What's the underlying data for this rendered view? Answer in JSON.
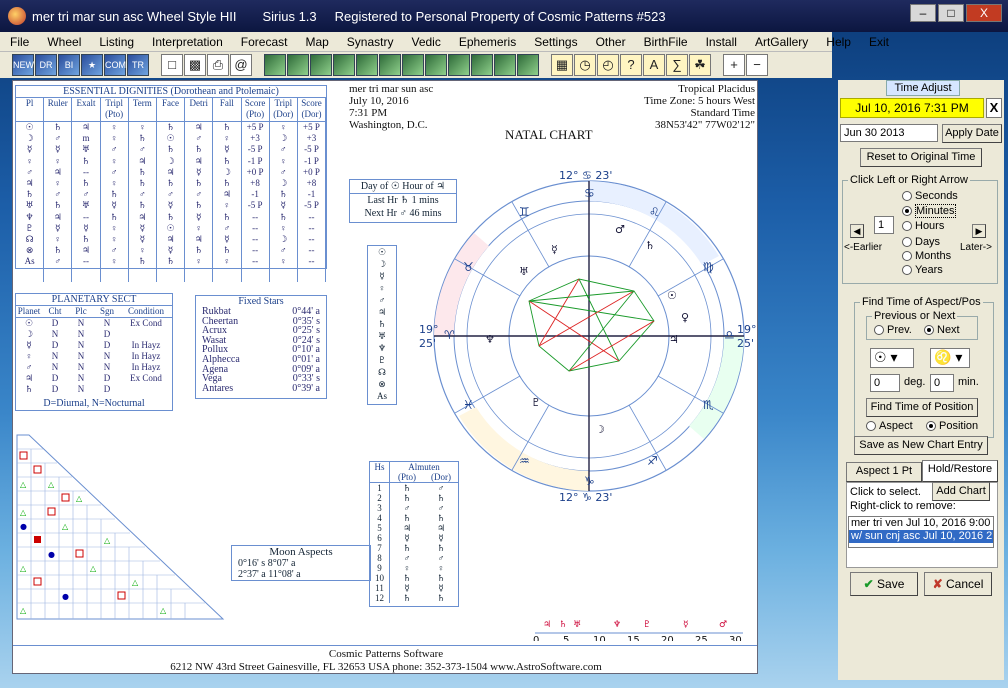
{
  "window": {
    "title": "mer tri mar sun asc Wheel Style HII",
    "app_version": "Sirius 1.3",
    "registered": "Registered to Personal Property of Cosmic Patterns #523",
    "btn_min": "–",
    "btn_max": "□",
    "btn_close": "X"
  },
  "menu": [
    "File",
    "Wheel",
    "Listing",
    "Interpretation",
    "Forecast",
    "Map",
    "Synastry",
    "Vedic",
    "Ephemeris",
    "Settings",
    "Other",
    "BirthFile",
    "Install",
    "ArtGallery",
    "Help",
    "Exit"
  ],
  "toolbar_labels": [
    "NEW",
    "DR",
    "BI",
    "",
    "COMP",
    "TR"
  ],
  "chart": {
    "name": "mer tri mar sun asc",
    "date": "July 10, 2016",
    "time": "7:31 PM",
    "place": "Washington, D.C.",
    "system": "Tropical Placidus",
    "zone": "Time Zone: 5 hours West",
    "standard": "Standard Time",
    "coords": "38N53'42\"  77W02'12\"",
    "natal_title": "NATAL CHART"
  },
  "dignities": {
    "title": "ESSENTIAL DIGNITIES (Dorothean and Ptolemaic)",
    "headers": [
      "Pl",
      "Ruler",
      "Exalt",
      "Tripl (Pto)",
      "Term",
      "Face",
      "Detri",
      "Fall",
      "Score (Pto)",
      "Tripl (Dor)",
      "Score (Dor)"
    ],
    "score_pto": [
      "+5 P",
      "+3",
      "-5 P",
      "-1 P",
      "+0 P",
      "+8",
      "-1",
      "-5 P",
      "--",
      "--",
      "--",
      "--",
      "--"
    ],
    "score_dor": [
      "+5 P",
      "+3",
      "-5 P",
      "-1 P",
      "+0 P",
      "+8",
      "-1",
      "-5 P",
      "--",
      "--",
      "--",
      "--",
      "--"
    ]
  },
  "sect": {
    "title": "PLANETARY SECT",
    "headers": [
      "Planet",
      "Cht",
      "Plc",
      "Sgn",
      "Condition"
    ],
    "rows": [
      [
        "☉",
        "D",
        "N",
        "N",
        "Ex Cond"
      ],
      [
        "☽",
        "N",
        "N",
        "D",
        ""
      ],
      [
        "☿",
        "D",
        "N",
        "D",
        "In Hayz"
      ],
      [
        "♀",
        "N",
        "N",
        "N",
        "In Hayz"
      ],
      [
        "♂",
        "N",
        "N",
        "N",
        "In Hayz"
      ],
      [
        "♃",
        "D",
        "N",
        "D",
        "Ex Cond"
      ],
      [
        "♄",
        "D",
        "N",
        "D",
        ""
      ]
    ],
    "footer": "D=Diurnal, N=Nocturnal"
  },
  "fixed_stars": {
    "title": "Fixed Stars",
    "rows": [
      [
        "Rukbat",
        "0°44' a"
      ],
      [
        "Cheertan",
        "0°35' s"
      ],
      [
        "Acrux",
        "0°25' s"
      ],
      [
        "Wasat",
        "0°24' s"
      ],
      [
        "Pollux",
        "0°10' a"
      ],
      [
        "Alphecca",
        "0°01' a"
      ],
      [
        "Agena",
        "0°09' a"
      ],
      [
        "Vega",
        "0°33' s"
      ],
      [
        "Antares",
        "0°39' a"
      ]
    ]
  },
  "day_hour": {
    "title": "Day of ☉  Hour of ♃",
    "last": "Last Hr ♄  1 mins",
    "next": "Next Hr ♂  46 mins"
  },
  "moon_aspects": {
    "title": "Moon Aspects",
    "rows": [
      "0°16' s   8°07' a",
      "2°37' a  11°08' a"
    ]
  },
  "almuten": {
    "title": "Almuten",
    "col1": "Hs",
    "col2": "(Pto)",
    "col3": "(Dor)",
    "houses": [
      "1",
      "2",
      "3",
      "4",
      "5",
      "6",
      "7",
      "8",
      "9",
      "10",
      "11",
      "12"
    ]
  },
  "wheel_labels": {
    "mc": "12° ♋ 23'",
    "ic": "12° ♑ 23'",
    "asc": "19°",
    "dsc": "19°",
    "asc_m": "25'",
    "dsc_m": "25'"
  },
  "transit_scale": [
    "0",
    "5",
    "10",
    "15",
    "20",
    "25",
    "30"
  ],
  "footer": {
    "company": "Cosmic Patterns Software",
    "address": "6212 NW 43rd Street   Gainesville, FL 32653   USA   phone: 352-373-1504   www.AstroSoftware.com"
  },
  "time_adjust": {
    "tab": "Time Adjust",
    "current": "Jul 10, 2016   7:31 PM",
    "close": "X",
    "date_input": "Jun 30 2013",
    "apply": "Apply Date",
    "reset": "Reset to Original Time",
    "click_group": "Click Left or Right Arrow",
    "step_value": "1",
    "units": [
      "Seconds",
      "Minutes",
      "Hours",
      "Days",
      "Months",
      "Years"
    ],
    "selected_unit": "Minutes",
    "earlier": "<-Earlier",
    "later": "Later->",
    "find_group": "Find Time of Aspect/Pos",
    "prev_next_label": "Previous or Next",
    "prev": "Prev.",
    "next": "Next",
    "deg_value": "0",
    "deg_label": "deg.",
    "min_value": "0",
    "min_label": "min.",
    "find_pos": "Find Time of Position",
    "aspect": "Aspect",
    "position": "Position",
    "save_entry": "Save as New Chart Entry",
    "tab_aspect": "Aspect 1 Pt",
    "tab_hold": "Hold/Restore",
    "click_select": "Click to select.",
    "right_click": "Right-click to remove:",
    "add_chart": "Add Chart",
    "list": [
      "mer tri ven Jul 10, 2016  9:00",
      "w/ sun cnj asc Jul 10, 2016  2"
    ],
    "save": "Save",
    "cancel": "Cancel"
  },
  "colors": {
    "accent": "#316ac5",
    "highlight": "#ffff00",
    "panel": "#ece9d8"
  }
}
